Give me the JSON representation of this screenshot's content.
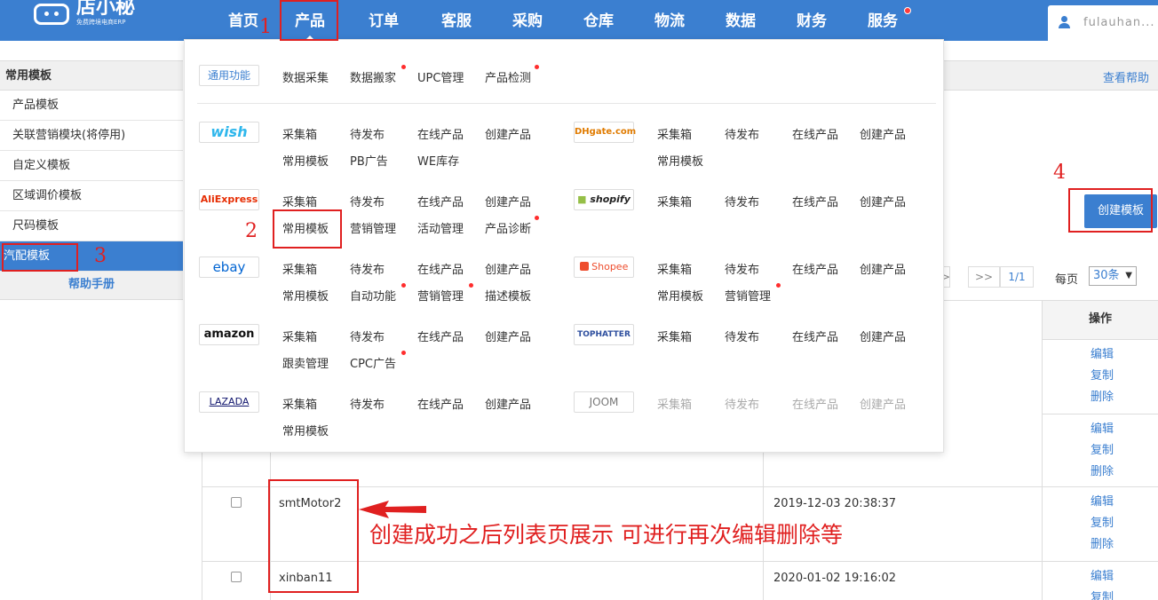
{
  "logo": {
    "name": "店小秘",
    "sub": "免费跨境电商ERP"
  },
  "nav": [
    "首页",
    "产品",
    "订单",
    "客服",
    "采购",
    "仓库",
    "物流",
    "数据",
    "财务",
    "服务"
  ],
  "user": {
    "name": "fulauhan..."
  },
  "sidebar": {
    "title": "常用模板",
    "items": [
      "产品模板",
      "关联营销模块(将停用)",
      "自定义模板",
      "区域调价模板",
      "尺码模板",
      "汽配模板"
    ],
    "help": "帮助手册"
  },
  "help_link": "查看帮助",
  "create_button": "创建模板",
  "pager": {
    "last": ">>",
    "next": ">",
    "page": "1/1",
    "per_page_label": "每页",
    "per_page": "30条"
  },
  "table": {
    "op_header": "操作",
    "ops": [
      "编辑",
      "复制",
      "删除"
    ],
    "rows": [
      {
        "name": "smtMotor2",
        "date": "2019-12-03 20:38:37"
      },
      {
        "name": "xinban11",
        "date": "2020-01-02 19:16:02"
      }
    ]
  },
  "dropdown": {
    "general": {
      "badge": "通用功能",
      "items": [
        "数据采集",
        "数据搬家",
        "UPC管理",
        "产品检测"
      ]
    },
    "platforms": {
      "wish": {
        "badge": "wish",
        "row1": [
          "采集箱",
          "待发布",
          "在线产品",
          "创建产品"
        ],
        "row2": [
          "常用模板",
          "PB广告",
          "WE库存"
        ]
      },
      "dhgate": {
        "badge": "DHgate.com",
        "row1": [
          "采集箱",
          "待发布",
          "在线产品",
          "创建产品"
        ],
        "row2": [
          "常用模板"
        ]
      },
      "aliexpress": {
        "badge": "AliExpress",
        "row1": [
          "采集箱",
          "待发布",
          "在线产品",
          "创建产品"
        ],
        "row2": [
          "常用模板",
          "营销管理",
          "活动管理",
          "产品诊断"
        ]
      },
      "shopify": {
        "badge": "shopify",
        "row1": [
          "采集箱",
          "待发布",
          "在线产品",
          "创建产品"
        ]
      },
      "ebay": {
        "badge": "ebay",
        "row1": [
          "采集箱",
          "待发布",
          "在线产品",
          "创建产品"
        ],
        "row2": [
          "常用模板",
          "自动功能",
          "营销管理",
          "描述模板"
        ]
      },
      "shopee": {
        "badge": "Shopee",
        "row1": [
          "采集箱",
          "待发布",
          "在线产品",
          "创建产品"
        ],
        "row2": [
          "常用模板",
          "营销管理"
        ]
      },
      "amazon": {
        "badge": "amazon",
        "row1": [
          "采集箱",
          "待发布",
          "在线产品",
          "创建产品"
        ],
        "row2": [
          "跟卖管理",
          "CPC广告"
        ]
      },
      "tophatter": {
        "badge": "TOPHATTER",
        "row1": [
          "采集箱",
          "待发布",
          "在线产品",
          "创建产品"
        ]
      },
      "lazada": {
        "badge": "LAZADA",
        "row1": [
          "采集箱",
          "待发布",
          "在线产品",
          "创建产品"
        ],
        "row2": [
          "常用模板"
        ]
      },
      "joom": {
        "badge": "JOOM",
        "row1": [
          "采集箱",
          "待发布",
          "在线产品",
          "创建产品"
        ]
      }
    }
  },
  "annotations": {
    "numbers": [
      "1",
      "2",
      "3",
      "4"
    ],
    "note": "创建成功之后列表页展示 可进行再次编辑删除等"
  },
  "colors": {
    "primary": "#3b7fd0",
    "annotation": "#e02020",
    "dot": "#ff2d2d"
  }
}
